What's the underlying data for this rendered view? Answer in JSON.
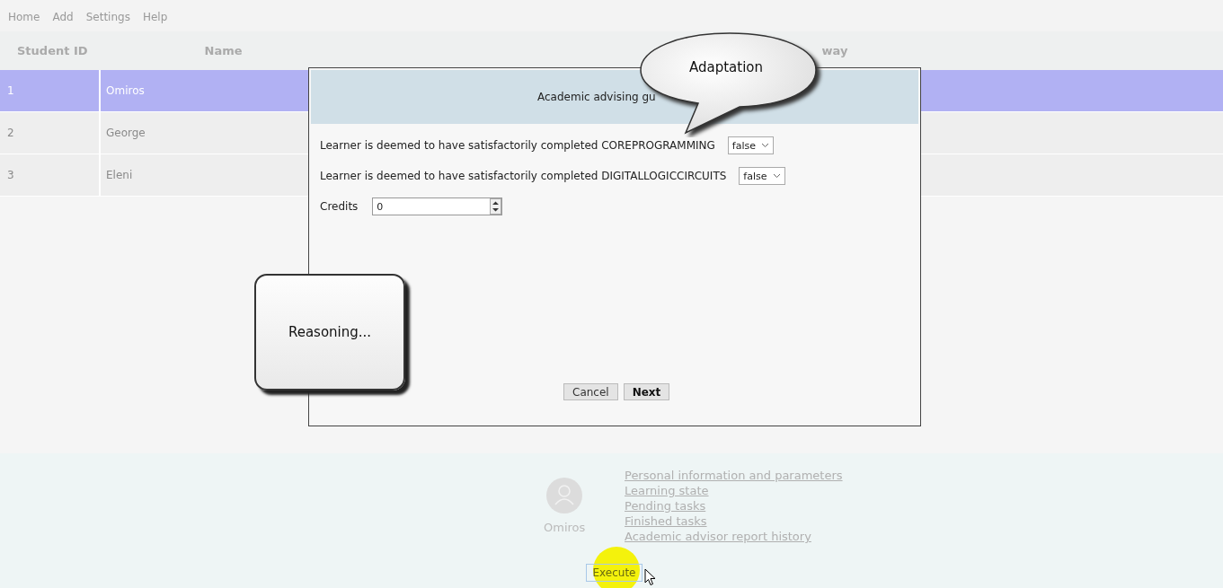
{
  "menu": [
    {
      "label": "Home"
    },
    {
      "label": "Add"
    },
    {
      "label": "Settings"
    },
    {
      "label": "Help"
    }
  ],
  "table": {
    "columns": [
      "Student ID",
      "Name",
      "way"
    ],
    "rows": [
      {
        "cells": [
          "1",
          "Omiros"
        ],
        "selected": true
      },
      {
        "cells": [
          "2",
          "George"
        ],
        "selected": false
      },
      {
        "cells": [
          "3",
          "Eleni"
        ],
        "selected": false
      }
    ]
  },
  "dialog": {
    "title": "Academic advising gu",
    "fields": [
      {
        "kind": "select",
        "label": "Learner is deemed to have satisfactorily completed COREPROGRAMMING",
        "value": "false"
      },
      {
        "kind": "select",
        "label": "Learner is deemed to have satisfactorily completed DIGITALLOGICCIRCUITS",
        "value": "false"
      },
      {
        "kind": "spinner",
        "label": "Credits",
        "value": "0"
      }
    ],
    "buttons": [
      {
        "label": "Cancel",
        "default": false
      },
      {
        "label": "Next",
        "default": true
      }
    ]
  },
  "callouts": [
    {
      "kind": "speech",
      "text": "Adaptation"
    },
    {
      "kind": "box",
      "text": "Reasoning..."
    }
  ],
  "profile": {
    "name": "Omiros",
    "links": [
      "Personal information and parameters",
      "Learning state",
      "Pending tasks",
      "Finished tasks",
      "Academic advisor report history"
    ]
  },
  "execute_button": {
    "label": "Execute"
  }
}
